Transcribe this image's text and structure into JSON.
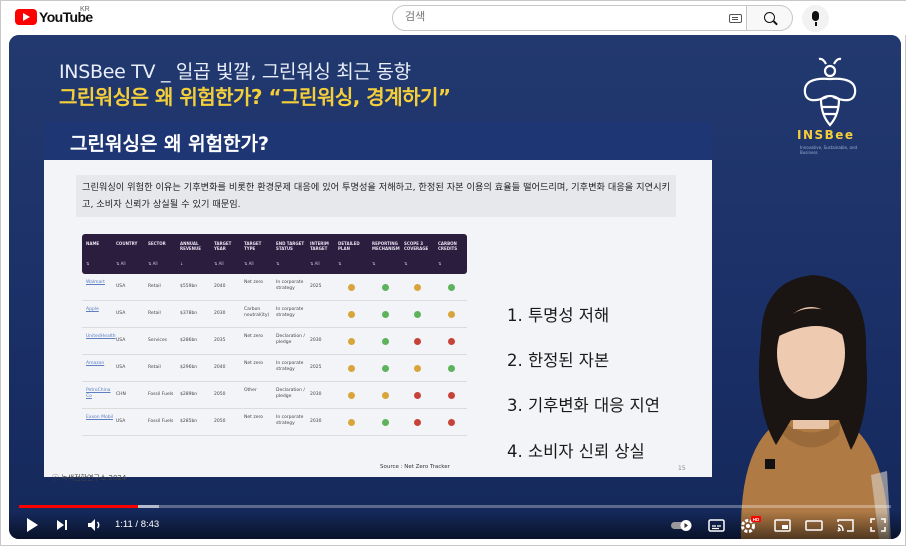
{
  "masthead": {
    "logo_text": "YouTube",
    "region": "KR",
    "search_placeholder": "검색",
    "icons": [
      "youtube-logo",
      "keyboard-icon",
      "search-icon",
      "mic-icon"
    ]
  },
  "video": {
    "headline1": "INSBee TV _ 일곱 빛깔, 그린워싱 최근 동향",
    "headline2_plain": "그린워싱은 왜 위험한가? ",
    "headline2_strong": "“그린워싱, 경계하기”",
    "brand": "INSBee",
    "brand_tagline": "Innovative, Sustainable, and Business",
    "slide": {
      "title": "그린워싱은 왜 위험한가?",
      "description": "그린워싱이 위험한 이유는 기후변화를 비롯한 환경문제 대응에 있어 투명성을 저해하고, 한정된 자본 이용의 효율들 떨어드리며, 기후변화 대응을 지연시키고, 소비자 신뢰가 상실될 수 있기 때문임.",
      "table": {
        "headers": [
          "NAME",
          "COUNTRY",
          "SECTOR",
          "ANNUAL REVENUE",
          "TARGET YEAR",
          "TARGET TYPE",
          "END TARGET STATUS",
          "INTERIM TARGET",
          "DETAILED PLAN",
          "REPORTING MECHANISM",
          "SCOPE 3 COVERAGE",
          "CARBON CREDITS"
        ],
        "sort_labels": [
          "⇅",
          "⇅ All",
          "⇅ All",
          "↓",
          "⇅ All",
          "⇅ All",
          "⇅",
          "⇅ All",
          "⇅",
          "⇅",
          "⇅",
          "⇅"
        ],
        "rows": [
          {
            "name": "Walmart",
            "country": "USA",
            "sector": "Retail",
            "revenue": "$559bn",
            "year": "2040",
            "type": "Net zero",
            "status": "In corporate strategy",
            "interim": "2025",
            "dots": [
              "#d9a43a",
              "#5cb35c",
              "#d9a43a",
              "#5cb35c"
            ]
          },
          {
            "name": "Apple",
            "country": "USA",
            "sector": "Retail",
            "revenue": "$378bn",
            "year": "2030",
            "type": "Carbon neutral(ity)",
            "status": "In corporate strategy",
            "interim": "",
            "dots": [
              "#d9a43a",
              "#5cb35c",
              "#5cb35c",
              "#d9a43a"
            ]
          },
          {
            "name": "UnitedHealth",
            "country": "USA",
            "sector": "Services",
            "revenue": "$286bn",
            "year": "2035",
            "type": "Net zero",
            "status": "Declaration / pledge",
            "interim": "2030",
            "dots": [
              "#d9a43a",
              "#5cb35c",
              "#c7433a",
              "#c7433a"
            ]
          },
          {
            "name": "Amazon",
            "country": "USA",
            "sector": "Retail",
            "revenue": "$296bn",
            "year": "2040",
            "type": "Net zero",
            "status": "In corporate strategy",
            "interim": "2025",
            "dots": [
              "#d9a43a",
              "#5cb35c",
              "#d9a43a",
              "#5cb35c"
            ]
          },
          {
            "name": "PetroChina Co",
            "country": "CHN",
            "sector": "Fossil Fuels",
            "revenue": "$289bn",
            "year": "2050",
            "type": "Other",
            "status": "Declaration / pledge",
            "interim": "2030",
            "dots": [
              "#d9a43a",
              "#d9a43a",
              "#c7433a",
              "#c7433a"
            ]
          },
          {
            "name": "Exxon Mobil",
            "country": "USA",
            "sector": "Fossil Fuels",
            "revenue": "$285bn",
            "year": "2050",
            "type": "Net zero",
            "status": "In corporate strategy",
            "interim": "2030",
            "dots": [
              "#d9a43a",
              "#5cb35c",
              "#c7433a",
              "#c7433a"
            ]
          }
        ]
      },
      "list": [
        "1. 투명성 저해",
        "2. 한정된 자본",
        "3. 기후변화 대응 지연",
        "4. 소비자 신뢰 상실"
      ],
      "source": "Source : Net Zero Tracker",
      "copyright": "ⓒ 녹색전환연구소 2024",
      "page_number": "15"
    }
  },
  "player": {
    "current_time": "1:11",
    "duration": "8:43",
    "time_display": "1:11 / 8:43",
    "progress_played": 0.136,
    "progress_loaded": 0.16,
    "settings_badge": "HD",
    "autoplay_on": true,
    "controls": [
      "play-icon",
      "next-icon",
      "volume-icon",
      "autoplay-toggle",
      "subtitles-icon",
      "settings-icon",
      "miniplayer-icon",
      "theater-icon",
      "cast-icon",
      "fullscreen-icon"
    ]
  },
  "colors": {
    "accent_red": "#ff0000",
    "headline_yellow": "#f5cf3a",
    "slide_navy": "#1e3674",
    "table_header": "#2b1d3e"
  }
}
